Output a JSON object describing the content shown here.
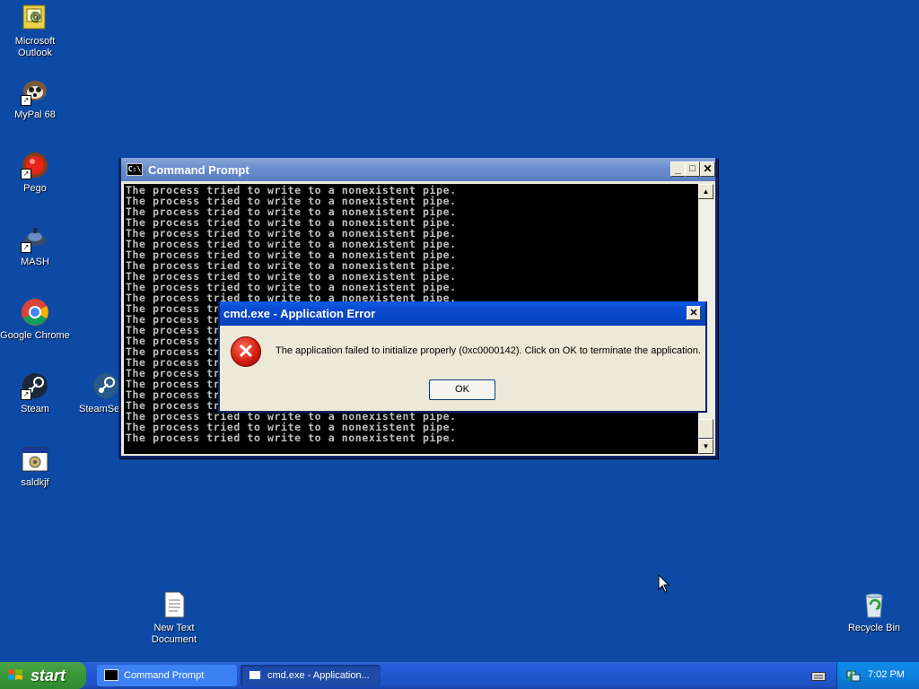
{
  "desktop": {
    "icons": [
      {
        "label": "Microsoft Outlook",
        "icon": "outlook-icon"
      },
      {
        "label": "MyPal 68",
        "icon": "mypal-icon"
      },
      {
        "label": "Pego",
        "icon": "pego-icon"
      },
      {
        "label": "MASH",
        "icon": "mash-icon"
      },
      {
        "label": "Google Chrome",
        "icon": "chrome-icon"
      },
      {
        "label": "Steam",
        "icon": "steam-icon"
      },
      {
        "label": "SteamSet",
        "icon": "steam-setup-icon"
      },
      {
        "label": "saldkjf",
        "icon": "program-icon"
      },
      {
        "label": "New Text Document",
        "icon": "text-document-icon"
      },
      {
        "label": "Recycle Bin",
        "icon": "recycle-bin-icon"
      }
    ]
  },
  "cmd_window": {
    "title": "Command Prompt",
    "line": "The process tried to write to a nonexistent pipe."
  },
  "dialog": {
    "title": "cmd.exe - Application Error",
    "message": "The application failed to initialize properly (0xc0000142). Click on OK to terminate the application.",
    "ok_label": "OK"
  },
  "taskbar": {
    "start_label": "start",
    "buttons": [
      {
        "label": "Command Prompt"
      },
      {
        "label": "cmd.exe - Application..."
      }
    ],
    "clock": "7:02 PM"
  },
  "colors": {
    "desktop_bg": "#0d4aa6",
    "titlebar_active": "#0846c7",
    "error_red": "#d01a0e"
  }
}
